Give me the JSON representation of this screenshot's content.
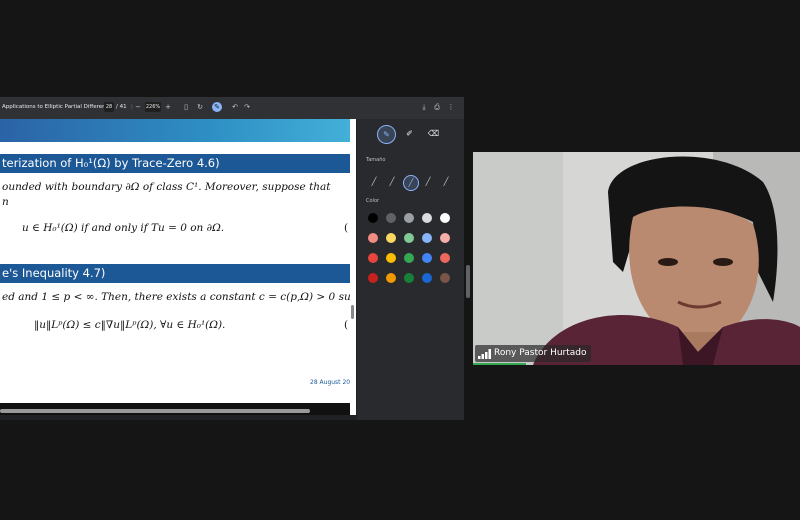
{
  "pdf_toolbar": {
    "title": "Applications to Elliptic Partial Differen...",
    "page_current": "28",
    "page_total": "/ 41",
    "zoom_out": "−",
    "zoom": "226%",
    "zoom_in": "+"
  },
  "slide": {
    "block1_title": "terization of H₀¹(Ω) by Trace-Zero 4.6)",
    "block1_line1": "ounded with boundary ∂Ω of class C¹. Moreover, suppose that",
    "block1_line2": "n",
    "block1_eq": "u ∈ H₀¹(Ω)     if and only if     Tu = 0 on ∂Ω.",
    "block1_paren": "(",
    "block2_title": "e's Inequality 4.7)",
    "block2_line1": "ed and 1 ≤ p < ∞. Then, there exists a constant c = c(p,Ω) > 0 su",
    "block2_eq": "‖u‖Lᵖ(Ω) ≤ c‖∇u‖Lᵖ(Ω),     ∀u ∈ H₀¹(Ω).",
    "block2_paren": "(",
    "date": "28 August 20"
  },
  "annotation_panel": {
    "size_label": "Tamaño",
    "color_label": "Color",
    "colors": [
      [
        "#000000",
        "#5f6368",
        "#9aa0a6",
        "#dadce0",
        "#ffffff"
      ],
      [
        "#f28b82",
        "#fdd663",
        "#81c995",
        "#8ab4f8",
        "#f6aea9"
      ],
      [
        "#e8453c",
        "#fbbc04",
        "#34a853",
        "#4285f4",
        "#ee675c"
      ],
      [
        "#c5221f",
        "#f29900",
        "#188038",
        "#1967d2",
        "#795548"
      ]
    ]
  },
  "video": {
    "participant_name": "Rony Pastor Hurtado"
  }
}
